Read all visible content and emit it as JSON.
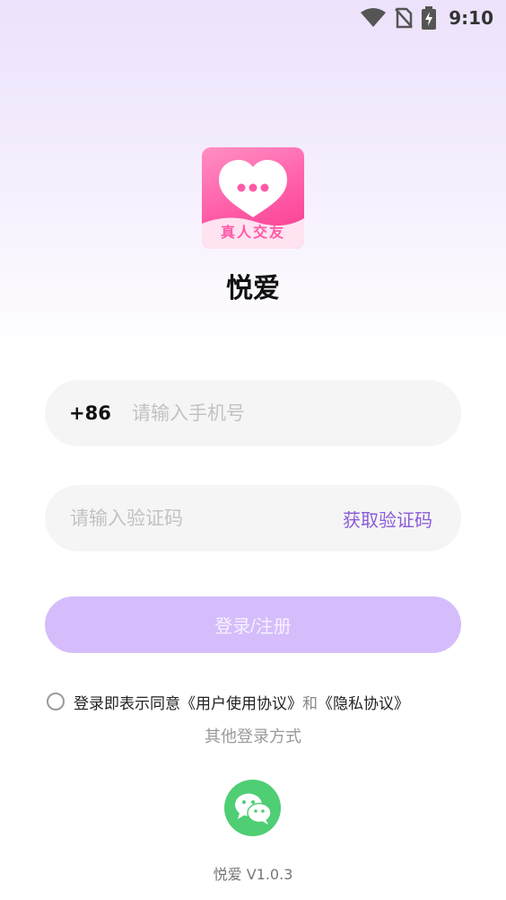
{
  "status_bar": {
    "time": "9:10",
    "icons": [
      "wifi-icon",
      "no-sim-icon",
      "battery-charging-icon"
    ]
  },
  "logo": {
    "text": "真人交友",
    "icon": "chat-heart-icon",
    "colors": {
      "primary": "#ff5aa6",
      "light": "#ffffff"
    }
  },
  "app_name": "悦爱",
  "phone_field": {
    "country_code": "+86",
    "placeholder": "请输入手机号",
    "value": ""
  },
  "code_field": {
    "placeholder": "请输入验证码",
    "value": "",
    "get_code_label": "获取验证码"
  },
  "login_button": {
    "label": "登录/注册"
  },
  "agreement": {
    "checked": false,
    "prefix": "登录即表示同意",
    "user_agreement": "《用户使用协议》",
    "and": "和",
    "privacy_policy": "《隐私协议》"
  },
  "other_login": {
    "label": "其他登录方式",
    "wechat_icon": "wechat-icon"
  },
  "version": "悦爱 V1.0.3",
  "colors": {
    "accent": "#8a5cdb",
    "button": "#d5bdfb",
    "wechat": "#4fce74"
  }
}
